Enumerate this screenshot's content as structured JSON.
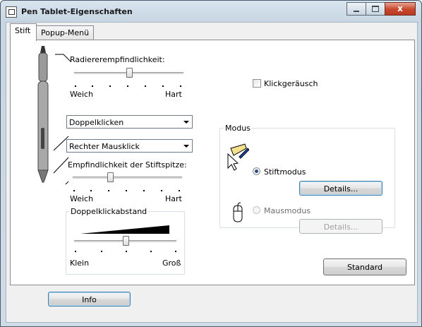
{
  "window": {
    "title": "Pen Tablet-Eigenschaften",
    "close_label": "x"
  },
  "tabs": [
    {
      "label": "Stift"
    },
    {
      "label": "Popup-Menü"
    }
  ],
  "eraser_sensitivity": {
    "label": "Radiererempfindlichkeit:",
    "min_label": "Weich",
    "max_label": "Hart",
    "value_fraction": 0.5
  },
  "click_sound": {
    "label": "Klickgeräusch",
    "checked": false
  },
  "upper_button": {
    "value": "Doppelklicken"
  },
  "lower_button": {
    "value": "Rechter Mausklick"
  },
  "tip_sensitivity": {
    "label": "Empfindlichkeit der Stiftspitze:",
    "min_label": "Weich",
    "max_label": "Hart",
    "value_fraction": 0.33
  },
  "double_click_distance": {
    "label": "Doppelklickabstand",
    "min_label": "Klein",
    "max_label": "Groß",
    "value_fraction": 0.5
  },
  "mode": {
    "label": "Modus",
    "pen_mode_label": "Stiftmodus",
    "mouse_mode_label": "Mausmodus",
    "details_label": "Details...",
    "details_disabled_label": "Details...",
    "selected": "pen"
  },
  "standard_button": "Standard",
  "info_button": "Info",
  "colors": {
    "accent": "#2a4d7d",
    "close": "#c8452c"
  }
}
